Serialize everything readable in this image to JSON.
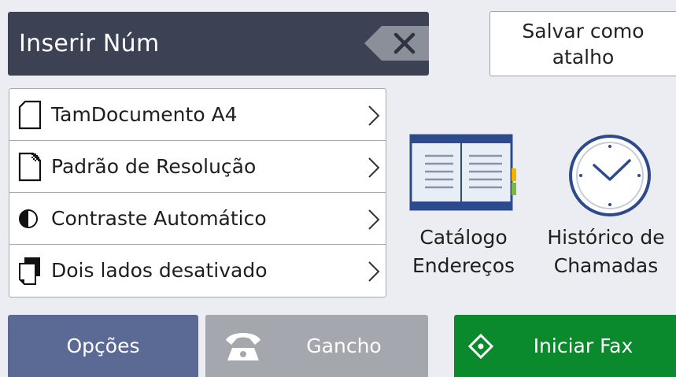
{
  "entry": {
    "placeholder": "Inserir Núm",
    "backspace_icon": "backspace-icon"
  },
  "shortcut": {
    "label": "Salvar como\natalho"
  },
  "settings": [
    {
      "icon": "document-size-icon",
      "label": "TamDocumento A4"
    },
    {
      "icon": "resolution-icon",
      "label": "Padrão de Resolução"
    },
    {
      "icon": "contrast-icon",
      "label": "Contraste Automático"
    },
    {
      "icon": "two-sided-icon",
      "label": "Dois lados desativado"
    }
  ],
  "tiles": {
    "address_book": {
      "label": "Catálogo\nEndereços",
      "icon": "address-book-icon"
    },
    "call_history": {
      "label": "Histórico de\nChamadas",
      "icon": "clock-icon"
    }
  },
  "buttons": {
    "options": "Opções",
    "hook": "Gancho",
    "start_fax": "Iniciar Fax"
  },
  "colors": {
    "entry_bar": "#3c4254",
    "options_button": "#5b6a94",
    "hook_button": "#a4a7ad",
    "start_fax_button": "#0a8a2c",
    "icon_blue": "#2c4a8c"
  }
}
